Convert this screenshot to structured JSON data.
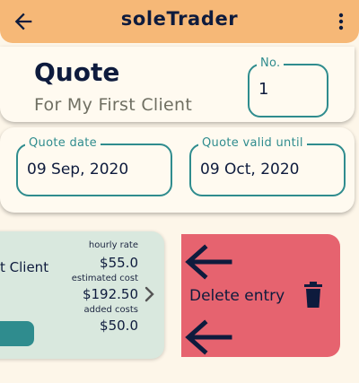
{
  "app": {
    "title": "soleTrader"
  },
  "quote": {
    "heading": "Quote",
    "client_line": "For My First Client",
    "number_label": "No.",
    "number_value": "1",
    "date_label": "Quote date",
    "date_value": "09 Sep, 2020",
    "valid_label": "Quote valid until",
    "valid_value": "09 Oct, 2020"
  },
  "entry": {
    "client_fragment": "t Client",
    "hourly_rate_label": "hourly rate",
    "hourly_rate_value": "$55.0",
    "estimated_cost_label": "estimated cost",
    "estimated_cost_value": "$192.50",
    "added_costs_label": "added costs",
    "added_costs_value": "$50.0"
  },
  "swipe": {
    "delete_label": "Delete entry"
  },
  "colors": {
    "appbar": "#f6b877",
    "accent_teal": "#2f8c8e",
    "entry_bg": "#d9e8de",
    "delete_bg": "#e6636f",
    "page_bg": "#fdf6e9"
  },
  "icons": [
    "back-arrow-icon",
    "more-vert-icon",
    "chevron-right-icon",
    "left-arrow-icon",
    "trash-icon"
  ]
}
